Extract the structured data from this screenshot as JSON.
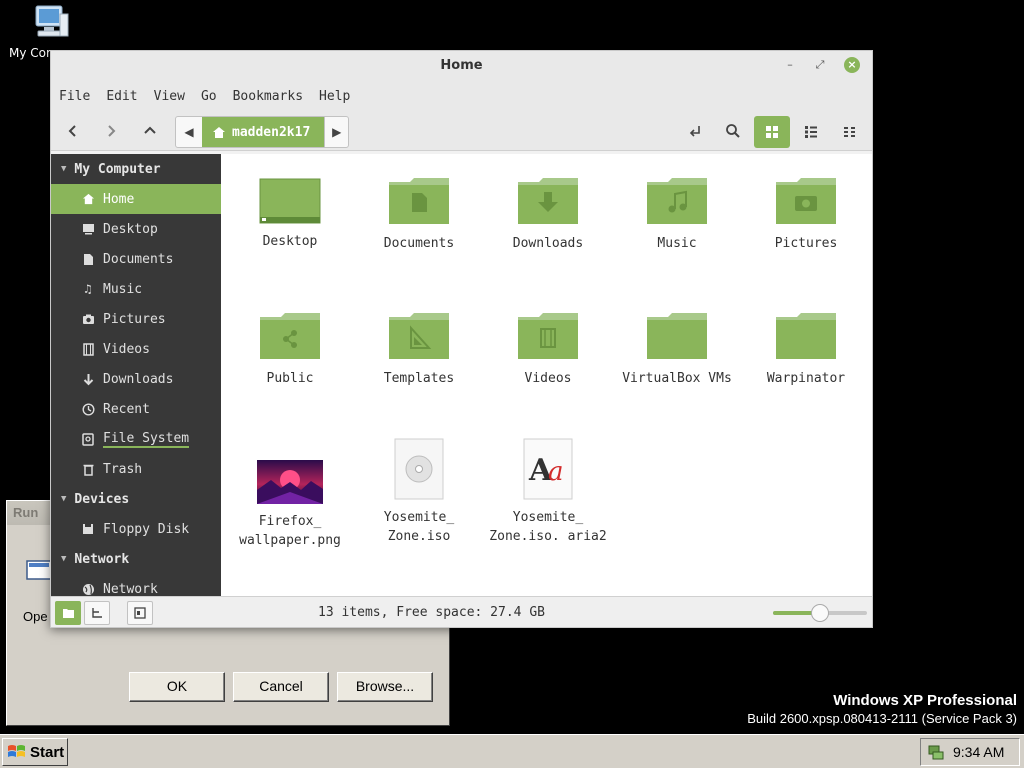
{
  "desktop": {
    "icon_label": "My Computer",
    "os_name": "Windows XP Professional",
    "build": "Build 2600.xpsp.080413-2111 (Service Pack 3)"
  },
  "run_dialog": {
    "title": "Run",
    "open_label": "Ope",
    "ok": "OK",
    "cancel": "Cancel",
    "browse": "Browse..."
  },
  "taskbar": {
    "start": "Start",
    "clock": "9:34 AM"
  },
  "window": {
    "title": "Home",
    "menu": [
      "File",
      "Edit",
      "View",
      "Go",
      "Bookmarks",
      "Help"
    ],
    "breadcrumb": "madden2k17",
    "accent": "#8ab55a"
  },
  "sidebar": {
    "sections": [
      {
        "title": "My Computer"
      },
      {
        "title": "Devices"
      },
      {
        "title": "Network"
      }
    ],
    "items": [
      {
        "label": "Home",
        "icon": "home-icon"
      },
      {
        "label": "Desktop",
        "icon": "desktop-icon"
      },
      {
        "label": "Documents",
        "icon": "document-icon"
      },
      {
        "label": "Music",
        "icon": "music-icon"
      },
      {
        "label": "Pictures",
        "icon": "camera-icon"
      },
      {
        "label": "Videos",
        "icon": "film-icon"
      },
      {
        "label": "Downloads",
        "icon": "download-icon"
      },
      {
        "label": "Recent",
        "icon": "clock-icon"
      },
      {
        "label": "File System",
        "icon": "drive-icon"
      },
      {
        "label": "Trash",
        "icon": "trash-icon"
      },
      {
        "label": "Floppy Disk",
        "icon": "floppy-icon"
      },
      {
        "label": "Network",
        "icon": "globe-icon"
      }
    ]
  },
  "files": [
    {
      "name": "Desktop",
      "icon": "desktop-folder-icon"
    },
    {
      "name": "Documents",
      "icon": "documents-folder-icon"
    },
    {
      "name": "Downloads",
      "icon": "downloads-folder-icon"
    },
    {
      "name": "Music",
      "icon": "music-folder-icon"
    },
    {
      "name": "Pictures",
      "icon": "pictures-folder-icon"
    },
    {
      "name": "Public",
      "icon": "public-folder-icon"
    },
    {
      "name": "Templates",
      "icon": "templates-folder-icon"
    },
    {
      "name": "Videos",
      "icon": "videos-folder-icon"
    },
    {
      "name": "VirtualBox VMs",
      "icon": "folder-icon"
    },
    {
      "name": "Warpinator",
      "icon": "folder-icon"
    },
    {
      "name": "Firefox_ wallpaper.png",
      "icon": "image-thumbnail-icon"
    },
    {
      "name": "Yosemite_ Zone.iso",
      "icon": "disc-image-icon"
    },
    {
      "name": "Yosemite_ Zone.iso. aria2",
      "icon": "font-file-icon"
    }
  ],
  "status": {
    "text": "13 items, Free space: 27.4 GB",
    "zoom_level": 0.5
  }
}
